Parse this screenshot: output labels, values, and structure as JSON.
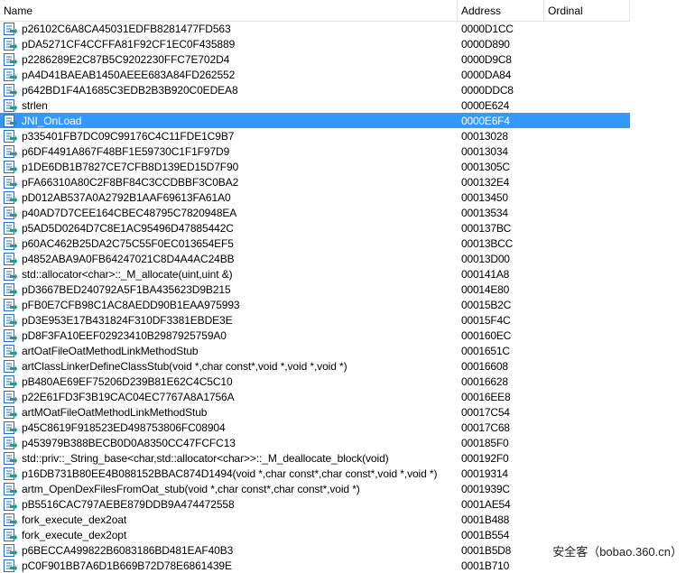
{
  "columns": {
    "name": "Name",
    "address": "Address",
    "ordinal": "Ordinal"
  },
  "selected_index": 6,
  "rows": [
    {
      "name": "p26102C6A8CA45031EDFB8281477FD563",
      "address": "0000D1CC",
      "ordinal": ""
    },
    {
      "name": "pDA5271CF4CCFFA81F92CF1EC0F435889",
      "address": "0000D890",
      "ordinal": ""
    },
    {
      "name": "p2286289E2C87B5C9202230FFC7E702D4",
      "address": "0000D9C8",
      "ordinal": ""
    },
    {
      "name": "pA4D41BAEAB1450AEEE683A84FD262552",
      "address": "0000DA84",
      "ordinal": ""
    },
    {
      "name": "p642BD1F4A1685C3EDB2B3B920C0EDEA8",
      "address": "0000DDC8",
      "ordinal": ""
    },
    {
      "name": "strlen",
      "address": "0000E624",
      "ordinal": ""
    },
    {
      "name": "JNI_OnLoad",
      "address": "0000E6F4",
      "ordinal": ""
    },
    {
      "name": "p335401FB7DC09C99176C4C11FDE1C9B7",
      "address": "00013028",
      "ordinal": ""
    },
    {
      "name": "p6DF4491A867F48BF1E59730C1F1F97D9",
      "address": "00013034",
      "ordinal": ""
    },
    {
      "name": "p1DE6DB1B7827CE7CFB8D139ED15D7F90",
      "address": "0001305C",
      "ordinal": ""
    },
    {
      "name": "pFA66310A80C2F8BF84C3CCDBBF3C0BA2",
      "address": "000132E4",
      "ordinal": ""
    },
    {
      "name": "pD012AB537A0A2792B1AAF69613FA61A0",
      "address": "00013450",
      "ordinal": ""
    },
    {
      "name": "p40AD7D7CEE164CBEC48795C7820948EA",
      "address": "00013534",
      "ordinal": ""
    },
    {
      "name": "p5AD5D0264D7C8E1AC95496D47885442C",
      "address": "000137BC",
      "ordinal": ""
    },
    {
      "name": "p60AC462B25DA2C75C55F0EC013654EF5",
      "address": "00013BCC",
      "ordinal": ""
    },
    {
      "name": "p4852ABA9A0FB64247021C8D4A4AC24BB",
      "address": "00013D00",
      "ordinal": ""
    },
    {
      "name": "std::allocator<char>::_M_allocate(uint,uint &)",
      "address": "000141A8",
      "ordinal": ""
    },
    {
      "name": "pD3667BED240792A5F1BA435623D9B215",
      "address": "00014E80",
      "ordinal": ""
    },
    {
      "name": "pFB0E7CFB98C1AC8AEDD90B1EAA975993",
      "address": "00015B2C",
      "ordinal": ""
    },
    {
      "name": "pD3E953E17B431824F310DF3381EBDE3E",
      "address": "00015F4C",
      "ordinal": ""
    },
    {
      "name": "pD8F3FA10EEF02923410B2987925759A0",
      "address": "000160EC",
      "ordinal": ""
    },
    {
      "name": "artOatFileOatMethodLinkMethodStub",
      "address": "0001651C",
      "ordinal": ""
    },
    {
      "name": "artClassLinkerDefineClassStub(void *,char const*,void *,void *,void *)",
      "address": "00016608",
      "ordinal": ""
    },
    {
      "name": "pB480AE69EF75206D239B81E62C4C5C10",
      "address": "00016628",
      "ordinal": ""
    },
    {
      "name": "p22E61FD3F3B19CAC04EC7767A8A1756A",
      "address": "00016EE8",
      "ordinal": ""
    },
    {
      "name": "artMOatFileOatMethodLinkMethodStub",
      "address": "00017C54",
      "ordinal": ""
    },
    {
      "name": "p45C8619F918523ED498753806FC08904",
      "address": "00017C68",
      "ordinal": ""
    },
    {
      "name": "p453979B388BECB0D0A8350CC47FCFC13",
      "address": "000185F0",
      "ordinal": ""
    },
    {
      "name": "std::priv::_String_base<char,std::allocator<char>>::_M_deallocate_block(void)",
      "address": "000192F0",
      "ordinal": ""
    },
    {
      "name": "p16DB731B80EE4B088152BBAC874D1494(void *,char const*,char const*,void *,void *)",
      "address": "00019314",
      "ordinal": ""
    },
    {
      "name": "artm_OpenDexFilesFromOat_stub(void *,char const*,char const*,void *)",
      "address": "0001939C",
      "ordinal": ""
    },
    {
      "name": "pB5516CAC797AEBE879DDB9A474472558",
      "address": "0001AE54",
      "ordinal": ""
    },
    {
      "name": "fork_execute_dex2oat",
      "address": "0001B488",
      "ordinal": ""
    },
    {
      "name": "fork_execute_dex2opt",
      "address": "0001B554",
      "ordinal": ""
    },
    {
      "name": "p6BECCA499822B6083186BD481EAF40B3",
      "address": "0001B5D8",
      "ordinal": ""
    },
    {
      "name": "pC0F901BB7A6D1B669B72D78E6861439E",
      "address": "0001B710",
      "ordinal": ""
    }
  ],
  "icon": "function-entry-icon",
  "colors": {
    "selection": "#3399ff",
    "icon_blue": "#1f6fc7",
    "icon_teal": "#1a9a9a"
  },
  "watermark": "安全客（bobao.360.cn）"
}
